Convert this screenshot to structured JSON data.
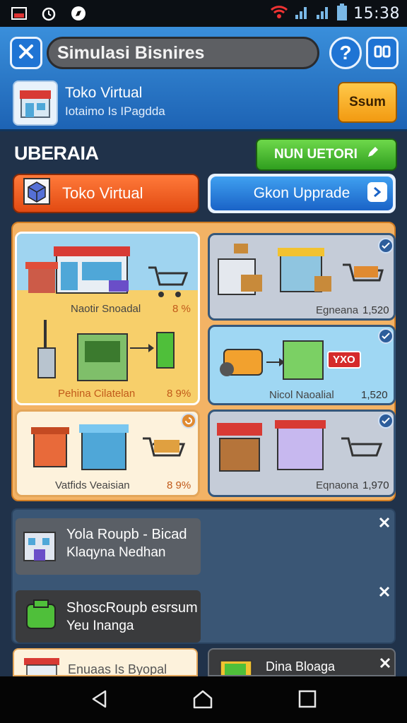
{
  "status_bar": {
    "time": "15:38"
  },
  "header": {
    "title": "Simulasi Bisnires",
    "close_icon": "close-icon",
    "help_symbol": "?",
    "menu_icon": "menu-icon"
  },
  "info": {
    "title": "Toko Virtual",
    "subtitle": "Iotaimo Is IPagdda",
    "sound_button": "Ssum"
  },
  "section": {
    "title": "UBERAIA",
    "green_button": "NUN UETORI",
    "tab_active": "Toko Virtual",
    "tab_upgrade": "Gkon Upprade"
  },
  "cards": [
    {
      "label_top": "Naotir Snoadal",
      "pct_top": "8 %",
      "label_bottom": "Pehina Cilatelan",
      "pct_bottom": "8 9%"
    },
    {
      "label": "Egneana",
      "value": "1,520"
    },
    {
      "label": "Nicol Naoalial",
      "value": "1,520",
      "badge": "YXO"
    },
    {
      "label": "Vatfids Veaisian",
      "value": "8 9%"
    },
    {
      "label": "Eqnaona",
      "value": "1,970"
    }
  ],
  "list_items": [
    {
      "title": "Yola Roupb - Bicad",
      "subtitle": "Klaqyna Nedhan"
    },
    {
      "title": "ShoscRoupb esrsum",
      "subtitle": "Yeu Inanga"
    }
  ],
  "bottom_peek": [
    {
      "title": "Enuaas Is Byopal"
    },
    {
      "title": "Dina Bloaga"
    }
  ],
  "colors": {
    "primary_blue": "#1f74d4",
    "accent_orange": "#e24a12",
    "accent_green": "#2f9e1e",
    "panel_orange": "#f3b365"
  }
}
